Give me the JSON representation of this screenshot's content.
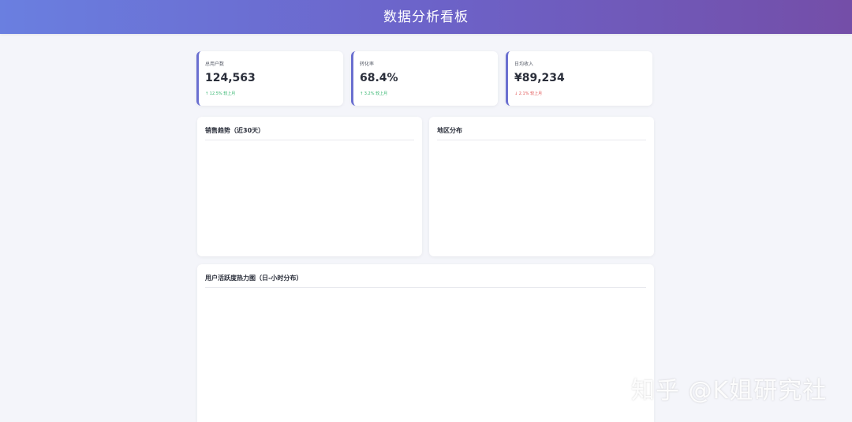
{
  "header": {
    "title": "数据分析看板"
  },
  "stats": [
    {
      "label": "总用户数",
      "value": "124,563",
      "change": "↑ 12.5% 较上月",
      "trend": "up"
    },
    {
      "label": "转化率",
      "value": "68.4%",
      "change": "↑ 3.2% 较上月",
      "trend": "up"
    },
    {
      "label": "日均收入",
      "value": "¥89,234",
      "change": "↓ 2.1% 较上月",
      "trend": "down"
    }
  ],
  "panels": {
    "sales_trend": {
      "title": "销售趋势（近30天）"
    },
    "region": {
      "title": "地区分布"
    },
    "heatmap": {
      "title": "用户活跃度热力图（日-小时分布）"
    }
  },
  "watermark": "知乎 @K姐研究社",
  "colors": {
    "header_start": "#6a7fe0",
    "header_end": "#744ea8",
    "accent": "#6a6fd0",
    "up": "#2fb36b",
    "down": "#e05252",
    "background": "#f4f5fa"
  }
}
